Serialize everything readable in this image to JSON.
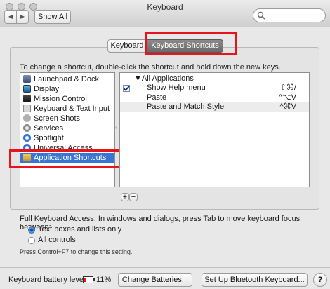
{
  "window": {
    "title": "Keyboard",
    "nav_back": "◀",
    "nav_forward": "▶",
    "show_all_label": "Show All",
    "search_placeholder": ""
  },
  "tabs": [
    {
      "label": "Keyboard",
      "selected": false
    },
    {
      "label": "Keyboard Shortcuts",
      "selected": true
    }
  ],
  "instruction": "To change a shortcut, double-click the shortcut and hold down the new keys.",
  "categories": [
    {
      "label": "Launchpad & Dock",
      "icon": "launchpad-icon"
    },
    {
      "label": "Display",
      "icon": "display-icon"
    },
    {
      "label": "Mission Control",
      "icon": "mission-control-icon"
    },
    {
      "label": "Keyboard & Text Input",
      "icon": "keyboard-icon"
    },
    {
      "label": "Screen Shots",
      "icon": "screenshot-icon"
    },
    {
      "label": "Services",
      "icon": "gear-icon"
    },
    {
      "label": "Spotlight",
      "icon": "spotlight-icon"
    },
    {
      "label": "Universal Access",
      "icon": "universal-access-icon"
    },
    {
      "label": "Application Shortcuts",
      "icon": "app-shortcuts-icon",
      "selected": true
    }
  ],
  "shortcuts": {
    "group_label": "▼All Applications",
    "rows": [
      {
        "name": "Show Help menu",
        "keys": "⇧⌘/",
        "checked": true
      },
      {
        "name": "Paste",
        "keys": "^⌥V"
      },
      {
        "name": "Paste and Match Style",
        "keys": "^⌘V"
      }
    ]
  },
  "add_label": "+",
  "remove_label": "−",
  "full_keyboard_access": {
    "label": "Full Keyboard Access: In windows and dialogs, press Tab to move keyboard focus between:",
    "options": [
      {
        "label": "Text boxes and lists only",
        "selected": true
      },
      {
        "label": "All controls",
        "selected": false
      }
    ],
    "hint": "Press Control+F7 to change this setting."
  },
  "footer": {
    "battery_label": "Keyboard battery level:",
    "battery_level": "11%",
    "change_batteries_label": "Change Batteries...",
    "bluetooth_label": "Set Up Bluetooth Keyboard...",
    "help_label": "?"
  },
  "colors": {
    "selection": "#3875d7",
    "highlight_box": "#e8131b"
  }
}
